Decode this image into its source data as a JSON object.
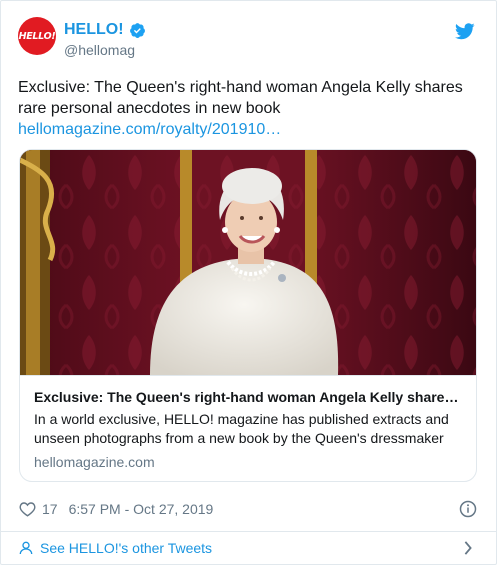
{
  "account": {
    "avatar_text": "HELLO!",
    "display_name": "HELLO!",
    "handle": "@hellomag",
    "brand_color": "#e11b22",
    "verified_icon": "verified-badge-icon",
    "platform_icon": "twitter-bird-icon"
  },
  "tweet": {
    "text": "Exclusive: The Queen's right-hand woman Angela Kelly shares rare personal anecdotes in new book",
    "link": "hellomagazine.com/royalty/201910…"
  },
  "card": {
    "image_description_icon": "photo",
    "title": "Exclusive: The Queen's right-hand woman Angela Kelly share…",
    "description": "In a world exclusive, HELLO! magazine has published extracts and unseen photographs from a new book by the Queen's dressmaker",
    "domain": "hellomagazine.com"
  },
  "meta": {
    "like_icon": "heart-icon",
    "like_count": "17",
    "timestamp": "6:57 PM - Oct 27, 2019",
    "info_icon": "info-icon"
  },
  "footer": {
    "see_more": "See HELLO!'s other Tweets"
  },
  "colors": {
    "link": "#1b95e0",
    "muted": "#657786",
    "text": "#14171a",
    "border": "#e1e8ed"
  }
}
